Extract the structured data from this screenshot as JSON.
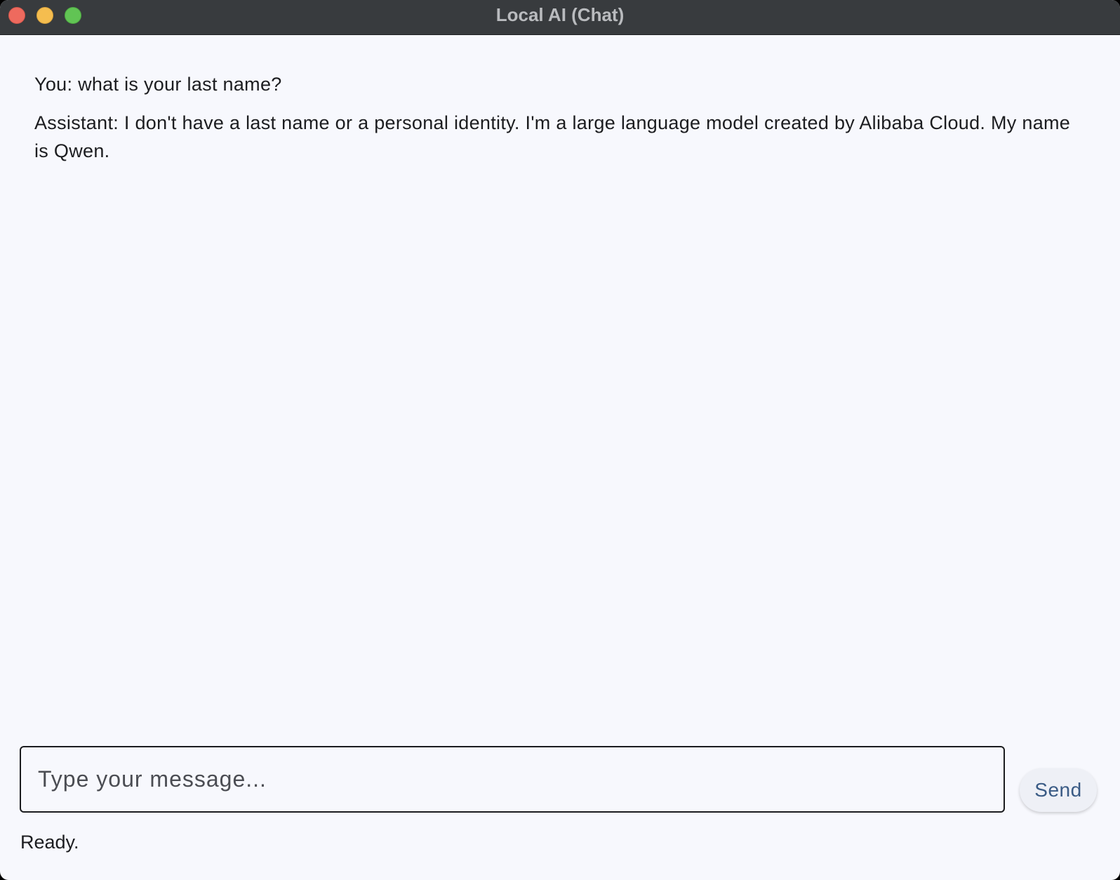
{
  "window": {
    "title": "Local AI (Chat)",
    "traffic_lights": {
      "close_color": "#ee6a5e",
      "minimize_color": "#f5bd4f",
      "zoom_color": "#61c454"
    }
  },
  "conversation": {
    "messages": [
      {
        "text": "You: what is your last name?"
      },
      {
        "text": "Assistant: I don't have a last name or a personal identity. I'm a large language model created by Alibaba Cloud. My name is Qwen."
      }
    ]
  },
  "composer": {
    "placeholder": "Type your message...",
    "value": "",
    "send_label": "Send"
  },
  "status": {
    "text": "Ready."
  },
  "colors": {
    "titlebar": "#383b3e",
    "background": "#f7f8fd",
    "send_text": "#3a5b85"
  }
}
